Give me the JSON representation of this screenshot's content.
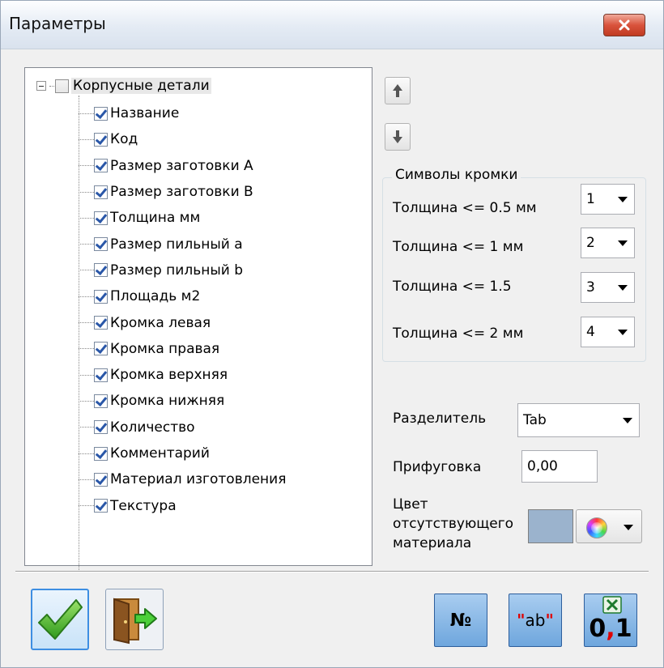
{
  "window": {
    "title": "Параметры",
    "close_icon": "close-x-icon"
  },
  "tree": {
    "root": {
      "label": "Корпусные детали",
      "checked": false,
      "expanded": true
    },
    "items": [
      {
        "label": "Название",
        "checked": true
      },
      {
        "label": "Код",
        "checked": true
      },
      {
        "label": "Размер заготовки А",
        "checked": true
      },
      {
        "label": "Размер заготовки В",
        "checked": true
      },
      {
        "label": "Толщина мм",
        "checked": true
      },
      {
        "label": "Размер пильный а",
        "checked": true
      },
      {
        "label": "Размер пильный b",
        "checked": true
      },
      {
        "label": "Площадь м2",
        "checked": true
      },
      {
        "label": "Кромка левая",
        "checked": true
      },
      {
        "label": "Кромка правая",
        "checked": true
      },
      {
        "label": "Кромка верхняя",
        "checked": true
      },
      {
        "label": "Кромка нижняя",
        "checked": true
      },
      {
        "label": "Количество",
        "checked": true
      },
      {
        "label": "Комментарий",
        "checked": true
      },
      {
        "label": "Материал изготовления",
        "checked": true
      },
      {
        "label": "Текстура",
        "checked": true
      }
    ]
  },
  "reorder": {
    "up_icon": "arrow-up-icon",
    "down_icon": "arrow-down-icon"
  },
  "edge_symbols": {
    "title": "Символы кромки",
    "rows": [
      {
        "label": "Толщина <= 0.5 мм",
        "value": "1"
      },
      {
        "label": "Толщина <= 1 мм",
        "value": "2"
      },
      {
        "label": "Толщина <= 1.5",
        "value": "3"
      },
      {
        "label": "Толщина <= 2 мм",
        "value": "4"
      }
    ]
  },
  "separator_field": {
    "label": "Разделитель",
    "value": "Tab"
  },
  "jointing_field": {
    "label": "Прифуговка",
    "value": "0,00"
  },
  "missing_color": {
    "label_line1": "Цвет",
    "label_line2": "отсутствующего",
    "label_line3": "материала",
    "swatch_color": "#9bb3cd",
    "picker_icon": "color-wheel-icon"
  },
  "footer": {
    "ok_icon": "checkmark-icon",
    "exit_icon": "exit-door-icon",
    "number_label": "№",
    "quote_label": "ab",
    "quote_mark": "\"",
    "excel_label_0": "0",
    "excel_comma": ",",
    "excel_label_1": "1",
    "excel_icon": "excel-icon"
  }
}
